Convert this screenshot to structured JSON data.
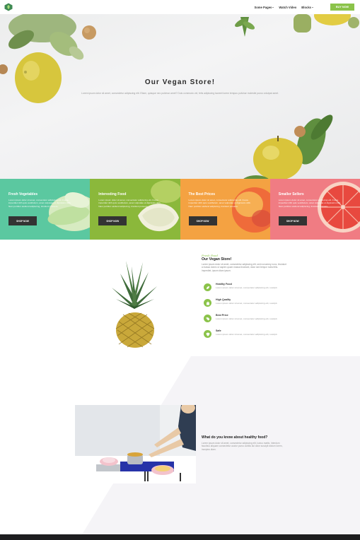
{
  "header": {
    "nav": [
      {
        "label": "Some Pages",
        "caret": true
      },
      {
        "label": "Watch Video",
        "caret": false
      },
      {
        "label": "Blocks",
        "caret": true
      }
    ],
    "buy_label": "BUY NOW"
  },
  "hero": {
    "title": "Our Vegan Store!",
    "subtitle": "Lorem ipsum dolor sit amet, consectetur adipiscing elit. Etiam, quisque nec pulvinar amet? Duis commodo vel, felis adipiscing laoreet lorem tempus pulvinar molestie purus volutpat amet."
  },
  "cards": [
    {
      "title": "Fresh Vegetables",
      "text": "Lorem ipsum dolor sit amet, consectetur adipiscing elit. Fusce imperdiet nibh quis vestibulum, amet vulputate ut dignissim nibh. Nam porttitor eleifend adipiscing, tincidunt posuere.",
      "button": "SHOP NOW",
      "color": "#5bc8a0"
    },
    {
      "title": "Interesting Food",
      "text": "Lorem ipsum dolor sit amet, consectetur adipiscing elit. Fusce imperdiet nibh quis vestibulum, amet vulputate ut dignissim nibh. Nam porttitor eleifend adipiscing, tincidunt posuere.",
      "button": "SHOP NOW",
      "color": "#8bb83b"
    },
    {
      "title": "The Best Prices",
      "text": "Lorem ipsum dolor sit amet, consectetur adipiscing elit. Fusce imperdiet nibh quis vestibulum, amet vulputate ut dignissim nibh. Nam porttitor eleifend adipiscing, tincidunt posuere.",
      "button": "SHOP NOW",
      "color": "#f4a242"
    },
    {
      "title": "Smaller Sellers",
      "text": "Lorem ipsum dolor sit amet, consectetur adipiscing elit. Fusce imperdiet nibh quis vestibulum, amet vulputate ut dignissim nibh. Nam porttitor eleifend adipiscing, tincidunt posuere.",
      "button": "SHOP NOW",
      "color": "#f07c83"
    }
  ],
  "about": {
    "script": "Fresh Food",
    "title": "Our Vegan Store!",
    "text": "Lorem ipsum dolor sit amet, consectetur adipiscing elit, sed nonummy nunc, tincidunt a massa donec ut sapien quam massa tincidunt, dolor sed tempor nulla felis. Imperdiet, ipsum diam ipsum.",
    "features": [
      {
        "title": "Healthy Food",
        "text": "Lorem ipsum dolor sit amet, consectetur adipiscing elit, suscipit.",
        "icon": "leaf-icon"
      },
      {
        "title": "High Quality",
        "text": "Lorem ipsum dolor sit amet, consectetur adipiscing elit, suscipit.",
        "icon": "bag-icon"
      },
      {
        "title": "Best Price",
        "text": "Lorem ipsum dolor sit amet, consectetur adipiscing elit, suscipit.",
        "icon": "tag-icon"
      },
      {
        "title": "Safe",
        "text": "Lorem ipsum dolor sit amet, consectetur adipiscing elit, suscipit.",
        "icon": "shield-icon"
      }
    ]
  },
  "healthy": {
    "title": "What do you know about healthy food?",
    "text": "Lorem ipsum dolor sit amet, consectetur adipiscing elit, luctus mattis. Interdum faucibus aliquam consectetur auctor purus cubilia dui dolor suscipit dictum lorem, inceptos diam."
  }
}
